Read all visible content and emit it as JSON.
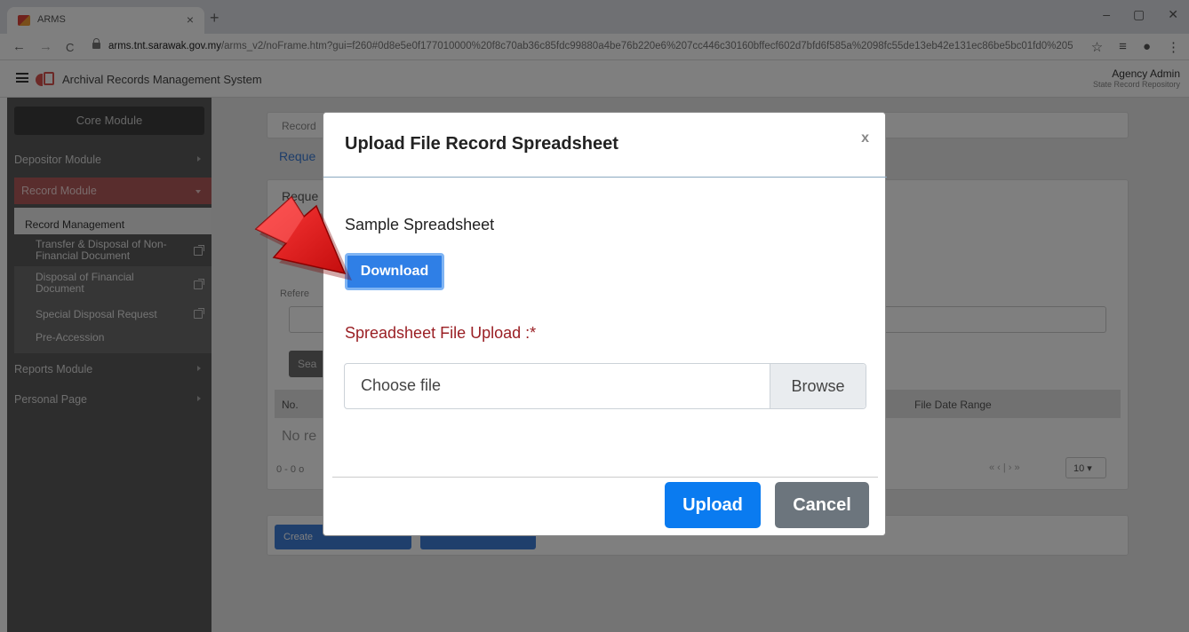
{
  "browser": {
    "tab_title": "ARMS",
    "tab_close": "×",
    "new_tab": "+",
    "url_host": "arms.tnt.sarawak.gov.my",
    "url_path": "/arms_v2/noFrame.htm?gui=f260#0d8e5e0f177010000%20f8c70ab36c85fdc99880a4be76b220e6%207cc446c30160bffecf602d7bfd6f585a%2098fc55de13eb42e131ec86be5bc01fd0%205...",
    "win_min": "–",
    "win_max": "▢",
    "win_close": "✕",
    "back": "←",
    "forward": "→",
    "reload": "C",
    "star": "☆",
    "reading": "≡",
    "profile": "●",
    "menu": "⋮"
  },
  "header": {
    "app_title": "Archival Records Management System",
    "user_name": "Agency Admin",
    "user_org": "State Record Repository"
  },
  "sidebar": {
    "core": "Core Module",
    "items": [
      {
        "label": "Depositor Module"
      },
      {
        "label": "Record Module"
      },
      {
        "label": "Reports Module"
      },
      {
        "label": "Personal Page"
      }
    ],
    "submenu_head": "Record Management",
    "subitems": [
      {
        "label": "Transfer & Disposal of Non-Financial Document"
      },
      {
        "label": "Disposal of Financial Document"
      },
      {
        "label": "Special Disposal Request"
      },
      {
        "label": "Pre-Accession"
      }
    ]
  },
  "background": {
    "breadcrumb": "Record",
    "tab_link": "Reque",
    "panel_title": "Reque",
    "reference_label": "Refere",
    "search_btn": "Sea",
    "col_no": "No.",
    "no_records": "No re",
    "pager_text": "0 - 0 o",
    "col_file_date_range": "File Date Range",
    "pager_nav": "« ‹ | › »",
    "page_size": "10",
    "create_btn": "Create"
  },
  "modal": {
    "title": "Upload File Record Spreadsheet",
    "close": "x",
    "sample_label": "Sample Spreadsheet",
    "download_label": "Download",
    "upload_label": "Spreadsheet File Upload :*",
    "file_placeholder": "Choose file",
    "browse_label": "Browse",
    "upload_button": "Upload",
    "cancel_button": "Cancel"
  },
  "colors": {
    "primary": "#0a7bf0",
    "danger_label": "#9a1f24",
    "sidebar_bg": "#5a5a5a",
    "active_module": "#b35b5b",
    "arrow": "#e31b1b"
  }
}
